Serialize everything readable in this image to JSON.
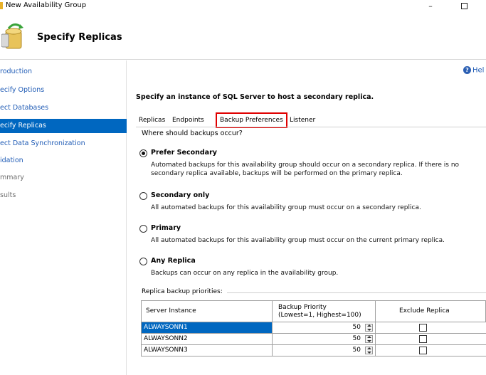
{
  "window": {
    "title": "New Availability Group",
    "minimize_glyph": "–"
  },
  "header": {
    "title": "Specify Replicas",
    "icon": "wizard-server-icon"
  },
  "sidebar": {
    "items": [
      {
        "label": "roduction",
        "state": "link"
      },
      {
        "label": "ecify Options",
        "state": "link"
      },
      {
        "label": "ect Databases",
        "state": "link"
      },
      {
        "label": "ecify Replicas",
        "state": "selected"
      },
      {
        "label": "ect Data Synchronization",
        "state": "link"
      },
      {
        "label": "idation",
        "state": "link"
      },
      {
        "label": "mmary",
        "state": "disabled"
      },
      {
        "label": "sults",
        "state": "disabled"
      }
    ]
  },
  "help": {
    "label": "Hel",
    "icon": "help-icon"
  },
  "instruction": "Specify an instance of SQL Server to host a secondary replica.",
  "tabs": [
    {
      "label": "Replicas"
    },
    {
      "label": "Endpoints"
    },
    {
      "label": "Backup Preferences",
      "active": true
    },
    {
      "label": "Listener"
    }
  ],
  "backup": {
    "question": "Where should backups occur?",
    "options": [
      {
        "label": "Prefer Secondary",
        "checked": true,
        "description": "Automated backups for this availability group should occur on a secondary replica. If there is no secondary replica available, backups will be performed on the primary replica."
      },
      {
        "label": "Secondary only",
        "checked": false,
        "description": "All automated backups for this availability group must occur on a secondary replica."
      },
      {
        "label": "Primary",
        "checked": false,
        "description": "All automated backups for this availability group must occur on the current primary replica."
      },
      {
        "label": "Any Replica",
        "checked": false,
        "description": "Backups can occur on any replica in the availability group."
      }
    ]
  },
  "priorities": {
    "label": "Replica backup priorities:",
    "columns": {
      "server": "Server Instance",
      "priority_line1": "Backup Priority",
      "priority_line2": "(Lowest=1, Highest=100)",
      "exclude": "Exclude Replica"
    },
    "rows": [
      {
        "server": "ALWAYSONN1",
        "priority": "50",
        "exclude": false,
        "selected": true
      },
      {
        "server": "ALWAYSONN2",
        "priority": "50",
        "exclude": false,
        "selected": false
      },
      {
        "server": "ALWAYSONN3",
        "priority": "50",
        "exclude": false,
        "selected": false
      }
    ]
  },
  "colors": {
    "link": "#1f5bb5",
    "selection": "#0067c0",
    "highlight_border": "#e00000"
  }
}
